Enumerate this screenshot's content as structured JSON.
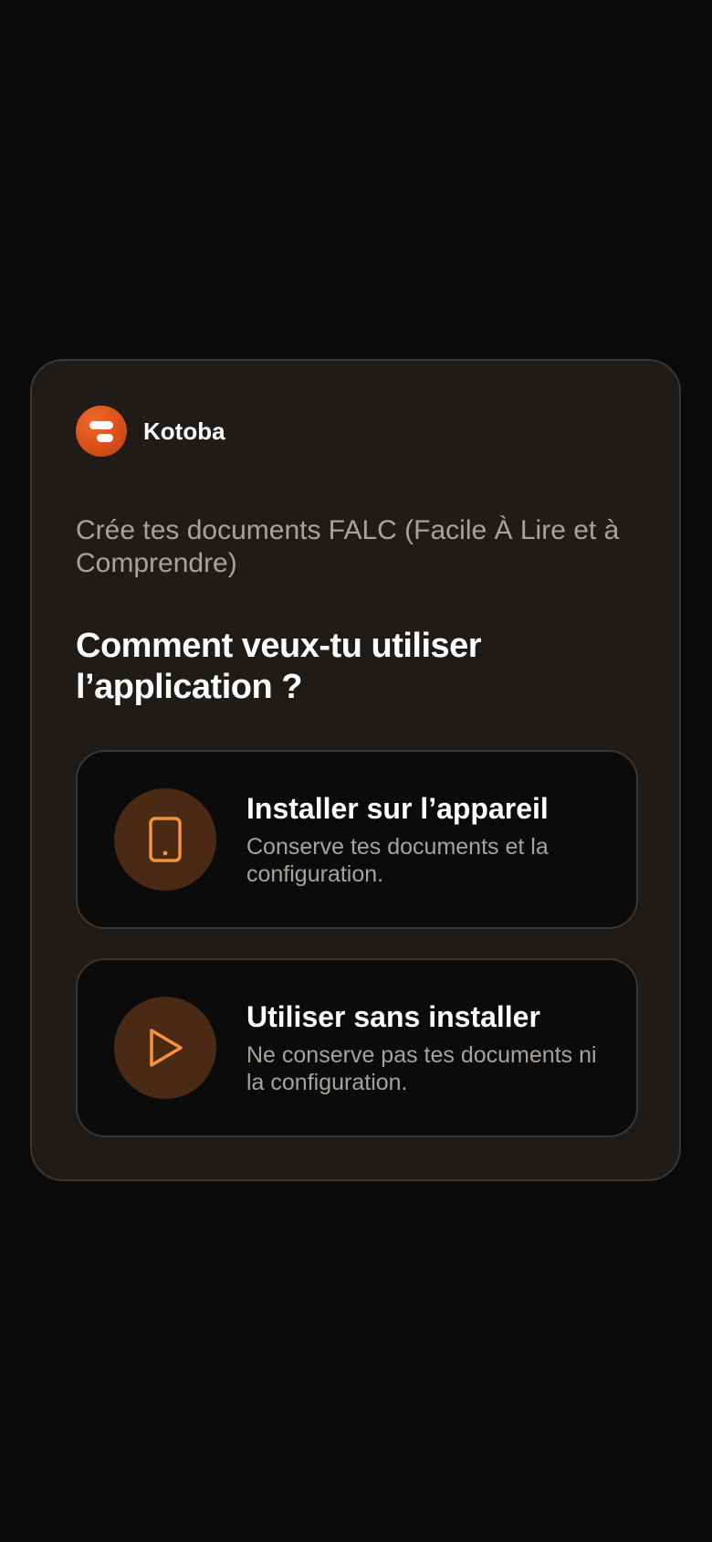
{
  "brand": {
    "name": "Kotoba",
    "logo_icon": "kotoba-logo-icon"
  },
  "subtitle": "Crée tes documents FALC (Facile À Lire et à Comprendre)",
  "question": "Comment veux-tu utiliser l’application ?",
  "options": [
    {
      "icon": "phone-icon",
      "title": "Installer sur l’appareil",
      "description": "Conserve tes documents et la configuration."
    },
    {
      "icon": "play-icon",
      "title": "Utiliser sans installer",
      "description": "Ne conserve pas tes documents ni la configuration."
    }
  ],
  "colors": {
    "background": "#0b0a0a",
    "card": "#1e1b19",
    "accent": "#f7913d",
    "icon_circle": "#4a2a14",
    "logo": "#d9501a",
    "muted_text": "#a8a29d"
  }
}
